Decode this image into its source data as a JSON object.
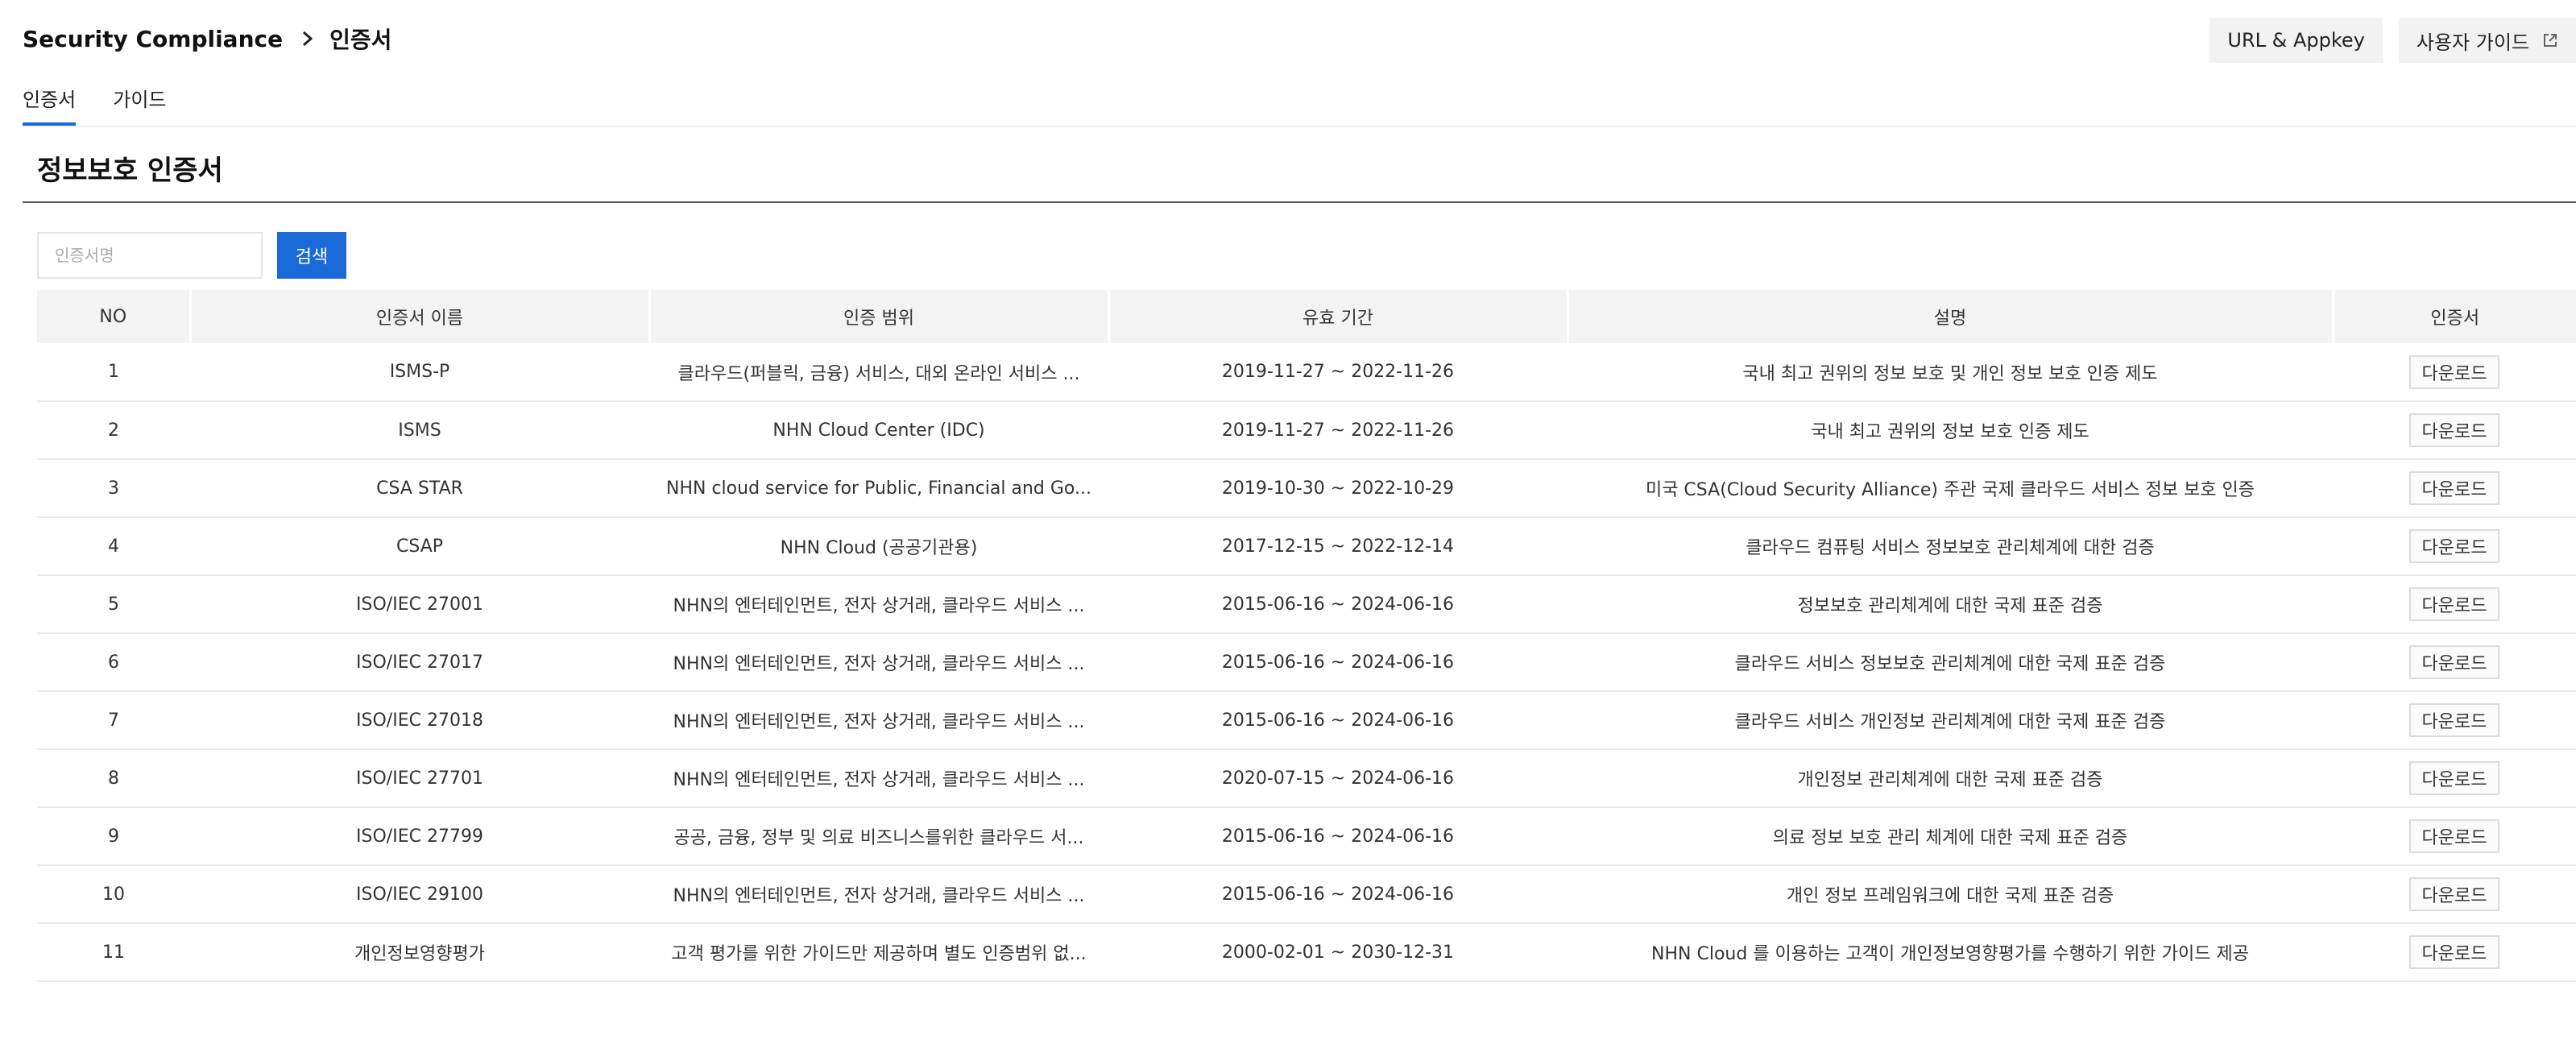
{
  "breadcrumb": {
    "service": "Security Compliance",
    "separator_icon": "chevron-right-icon",
    "page": "인증서"
  },
  "header_buttons": {
    "url_appkey": "URL & Appkey",
    "user_guide": "사용자 가이드",
    "user_guide_icon": "external-link-icon"
  },
  "tabs": [
    {
      "label": "인증서",
      "active": true
    },
    {
      "label": "가이드",
      "active": false
    }
  ],
  "section_title": "정보보호 인증서",
  "search": {
    "placeholder": "인증서명",
    "value": "",
    "button_label": "검색"
  },
  "colors": {
    "accent": "#1a6ad8",
    "header_bg": "#f3f3f3"
  },
  "table": {
    "columns": [
      "NO",
      "인증서 이름",
      "인증 범위",
      "유효 기간",
      "설명",
      "인증서"
    ],
    "download_label": "다운로드",
    "rows": [
      {
        "no": "1",
        "name": "ISMS-P",
        "scope": "클라우드(퍼블릭, 금융) 서비스, 대외 온라인 서비스 ...",
        "period": "2019-11-27 ~ 2022-11-26",
        "desc": "국내 최고 권위의 정보 보호 및 개인 정보 보호 인증 제도"
      },
      {
        "no": "2",
        "name": "ISMS",
        "scope": "NHN Cloud Center (IDC)",
        "period": "2019-11-27 ~ 2022-11-26",
        "desc": "국내 최고 권위의 정보 보호 인증 제도"
      },
      {
        "no": "3",
        "name": "CSA STAR",
        "scope": "NHN cloud service for Public, Financial and Go...",
        "period": "2019-10-30 ~ 2022-10-29",
        "desc": "미국 CSA(Cloud Security Alliance) 주관 국제 클라우드 서비스 정보 보호 인증"
      },
      {
        "no": "4",
        "name": "CSAP",
        "scope": "NHN Cloud (공공기관용)",
        "period": "2017-12-15 ~ 2022-12-14",
        "desc": "클라우드 컴퓨팅 서비스 정보보호 관리체계에 대한 검증"
      },
      {
        "no": "5",
        "name": "ISO/IEC 27001",
        "scope": "NHN의 엔터테인먼트, 전자 상거래, 클라우드 서비스 ...",
        "period": "2015-06-16 ~ 2024-06-16",
        "desc": "정보보호 관리체계에 대한 국제 표준 검증"
      },
      {
        "no": "6",
        "name": "ISO/IEC 27017",
        "scope": "NHN의 엔터테인먼트, 전자 상거래, 클라우드 서비스 ...",
        "period": "2015-06-16 ~ 2024-06-16",
        "desc": "클라우드 서비스 정보보호 관리체계에 대한 국제 표준 검증"
      },
      {
        "no": "7",
        "name": "ISO/IEC 27018",
        "scope": "NHN의 엔터테인먼트, 전자 상거래, 클라우드 서비스 ...",
        "period": "2015-06-16 ~ 2024-06-16",
        "desc": "클라우드 서비스 개인정보 관리체계에 대한 국제 표준 검증"
      },
      {
        "no": "8",
        "name": "ISO/IEC 27701",
        "scope": "NHN의 엔터테인먼트, 전자 상거래, 클라우드 서비스 ...",
        "period": "2020-07-15 ~ 2024-06-16",
        "desc": "개인정보 관리체계에 대한 국제 표준 검증"
      },
      {
        "no": "9",
        "name": "ISO/IEC 27799",
        "scope": "공공, 금융, 정부 및 의료 비즈니스를위한 클라우드 서...",
        "period": "2015-06-16 ~ 2024-06-16",
        "desc": "의료 정보 보호 관리 체계에 대한 국제 표준 검증"
      },
      {
        "no": "10",
        "name": "ISO/IEC 29100",
        "scope": "NHN의 엔터테인먼트, 전자 상거래, 클라우드 서비스 ...",
        "period": "2015-06-16 ~ 2024-06-16",
        "desc": "개인 정보 프레임워크에 대한 국제 표준 검증"
      },
      {
        "no": "11",
        "name": "개인정보영향평가",
        "scope": "고객 평가를 위한 가이드만 제공하며 별도 인증범위 없...",
        "period": "2000-02-01 ~ 2030-12-31",
        "desc": "NHN Cloud 를 이용하는 고객이 개인정보영향평가를 수행하기 위한 가이드 제공"
      }
    ]
  }
}
